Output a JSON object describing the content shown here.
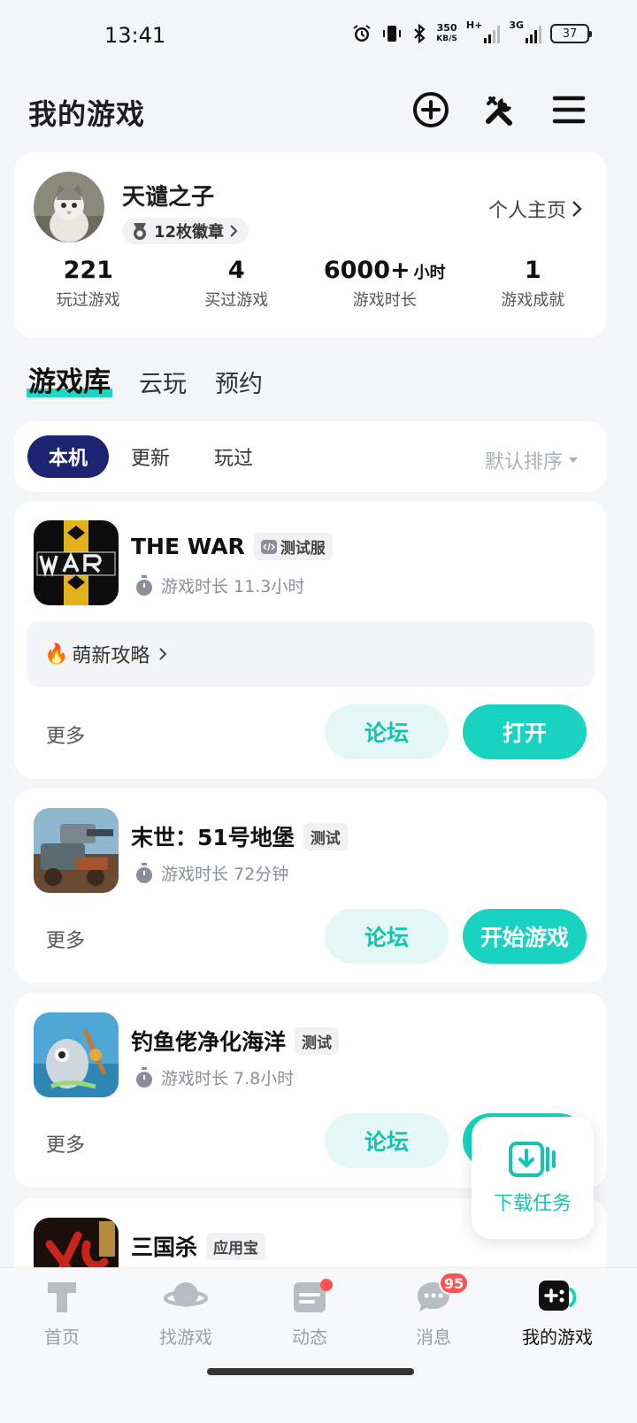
{
  "status_bar": {
    "time": "13:41",
    "speed_top": "350",
    "speed_unit": "KB/S",
    "network_a": "H+",
    "network_b": "3G",
    "battery": "37"
  },
  "header": {
    "title": "我的游戏",
    "icons": [
      "add-circle-icon",
      "tools-icon",
      "menu-icon"
    ]
  },
  "profile": {
    "username": "天谴之子",
    "badges": "12枚徽章",
    "homepage_link": "个人主页",
    "stats": [
      {
        "value": "221",
        "unit": "",
        "label": "玩过游戏"
      },
      {
        "value": "4",
        "unit": "",
        "label": "买过游戏"
      },
      {
        "value": "6000+",
        "unit": "小时",
        "label": "游戏时长"
      },
      {
        "value": "1",
        "unit": "",
        "label": "游戏成就"
      }
    ]
  },
  "main_tabs": [
    "游戏库",
    "云玩",
    "预约"
  ],
  "filters": {
    "tabs": [
      "本机",
      "更新",
      "玩过"
    ],
    "sort": "默认排序"
  },
  "games": [
    {
      "name": "THE WAR",
      "tag": "测试服",
      "playtime": "游戏时长 11.3小时",
      "guide": "萌新攻略",
      "more": "更多",
      "forum": "论坛",
      "action": "打开"
    },
    {
      "name": "末世：51号地堡",
      "tag": "测试",
      "playtime": "游戏时长 72分钟",
      "more": "更多",
      "forum": "论坛",
      "action": "开始游戏"
    },
    {
      "name": "钓鱼佬净化海洋",
      "tag": "测试",
      "playtime": "游戏时长 7.8小时",
      "more": "更多",
      "forum": "论坛",
      "action": ""
    },
    {
      "name": "三国杀",
      "tag": "应用宝"
    }
  ],
  "download_fab": {
    "label": "下载任务"
  },
  "bottom_nav": [
    {
      "label": "首页"
    },
    {
      "label": "找游戏"
    },
    {
      "label": "动态"
    },
    {
      "label": "消息",
      "badge": "95"
    },
    {
      "label": "我的游戏"
    }
  ],
  "colors": {
    "accent": "#17d3bf",
    "accent_light": "#e3f8f5",
    "filter_active": "#1d2573",
    "badge_red": "#ff5454"
  }
}
